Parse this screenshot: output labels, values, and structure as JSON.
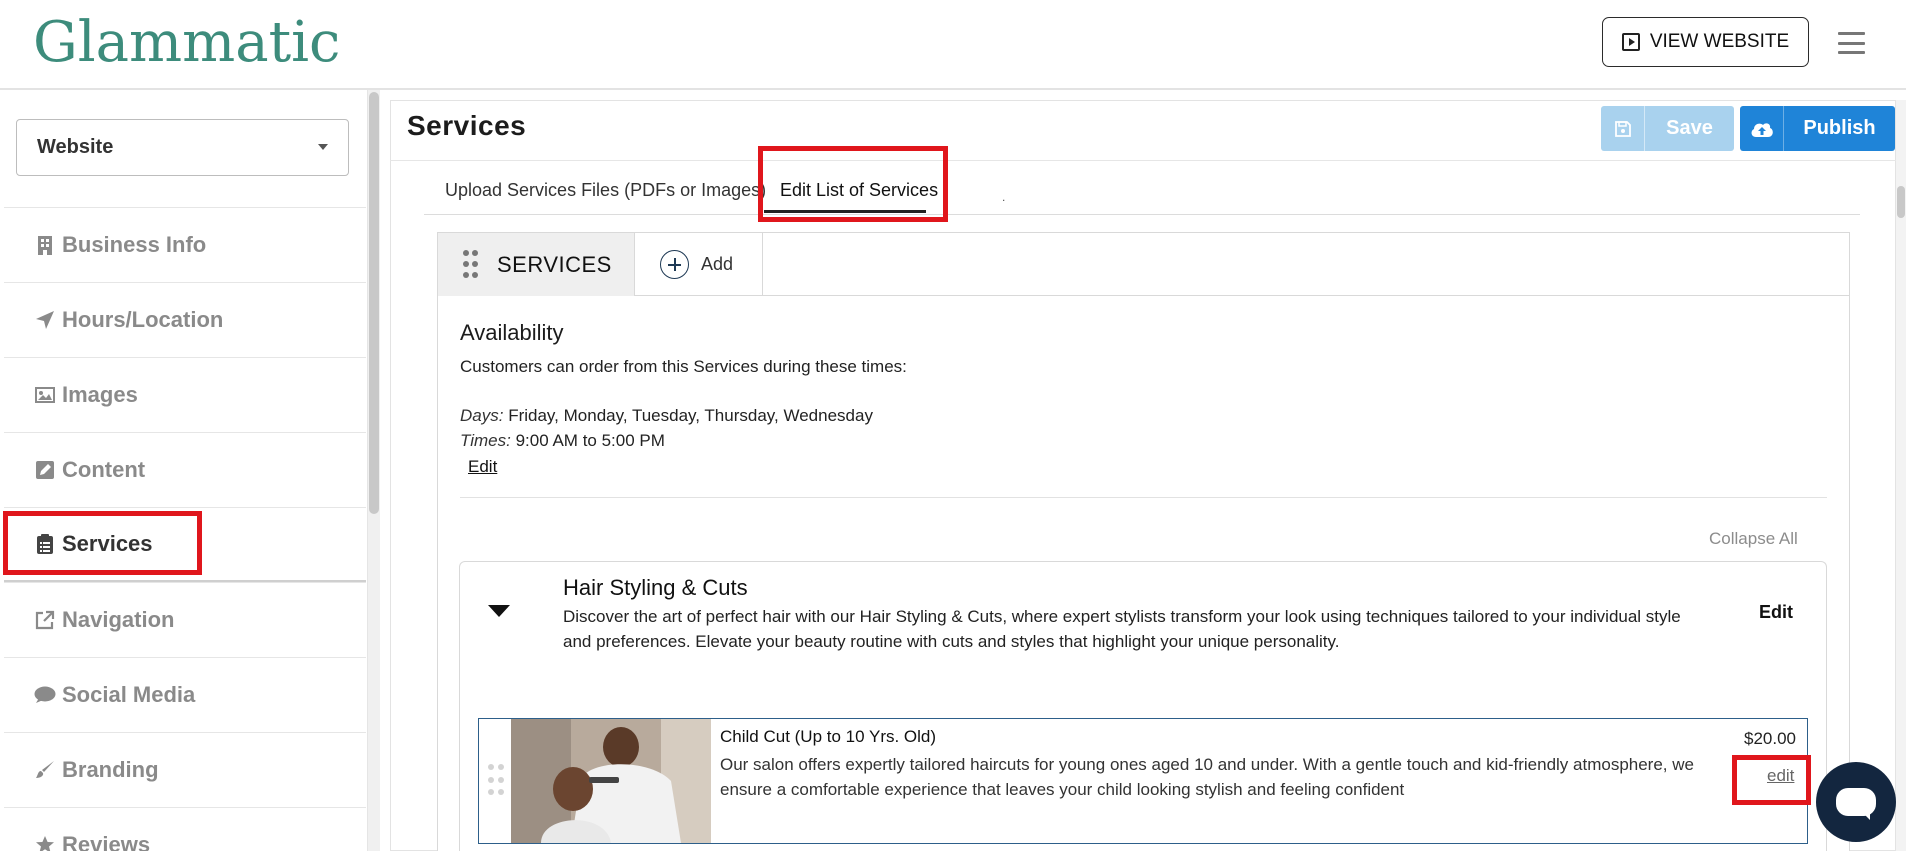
{
  "header": {
    "logo": "Glammatic",
    "view_website_label": "VIEW WEBSITE"
  },
  "sidebar": {
    "site_selector": "Website",
    "items": [
      {
        "label": "Business Info",
        "icon": "building-icon"
      },
      {
        "label": "Hours/Location",
        "icon": "location-arrow-icon"
      },
      {
        "label": "Images",
        "icon": "image-icon"
      },
      {
        "label": "Content",
        "icon": "edit-icon"
      },
      {
        "label": "Services",
        "icon": "clipboard-icon"
      },
      {
        "label": "Navigation",
        "icon": "external-link-icon"
      },
      {
        "label": "Social Media",
        "icon": "chat-bubble-icon"
      },
      {
        "label": "Branding",
        "icon": "brush-icon"
      },
      {
        "label": "Reviews",
        "icon": "star-icon"
      }
    ]
  },
  "main": {
    "title": "Services",
    "save_label": "Save",
    "publish_label": "Publish",
    "tabs": [
      {
        "label": "Upload Services Files (PDFs or Images)"
      },
      {
        "label": "Edit List of Services"
      }
    ],
    "tab_dot": "."
  },
  "services": {
    "header": "SERVICES",
    "add_label": "Add",
    "availability": {
      "title": "Availability",
      "description": "Customers can order from this Services during these times:",
      "days_label": "Days:",
      "days": "Friday, Monday, Tuesday, Thursday, Wednesday",
      "times_label": "Times:",
      "times": "9:00 AM to 5:00 PM",
      "edit_label": "Edit"
    },
    "collapse_all_label": "Collapse All",
    "category": {
      "title": "Hair Styling & Cuts",
      "description": "Discover the art of perfect hair with our Hair Styling & Cuts, where expert stylists transform your look using techniques tailored to your individual style and preferences. Elevate your beauty routine with cuts and styles that highlight your unique personality.",
      "edit_label": "Edit",
      "items": [
        {
          "name": "Child Cut (Up to 10 Yrs. Old)",
          "price": "$20.00",
          "description": "Our salon offers expertly tailored haircuts for young ones aged 10 and under. With a gentle touch and kid-friendly atmosphere, we ensure a comfortable experience that leaves your child looking stylish and feeling confident",
          "edit_label": "edit"
        }
      ]
    }
  },
  "colors": {
    "brand": "#3d8c7c",
    "publish": "#1f84d8",
    "save_disabled": "#a9d2ee",
    "highlight": "#e0161c",
    "chat": "#13263f"
  }
}
